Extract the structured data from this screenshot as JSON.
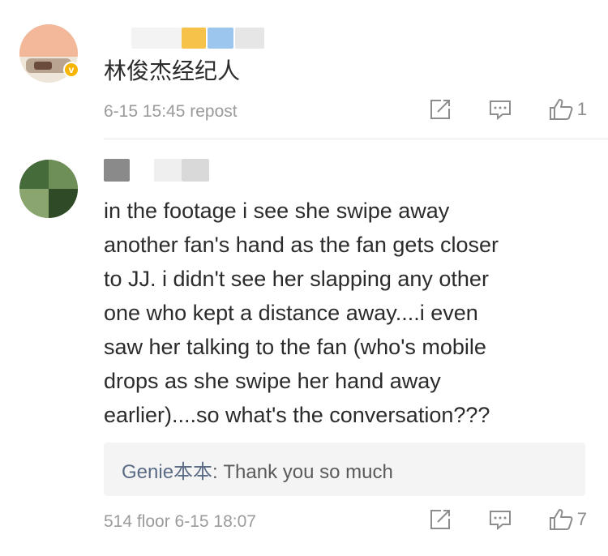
{
  "comments": [
    {
      "username_blur_colors": [
        "#f3f3f3",
        "#f6c24a",
        "#9cc6ee",
        "#e6e6e6"
      ],
      "verified_badge": "v",
      "text": "林俊杰经纪人",
      "meta": "6-15 15:45 repost",
      "actions": {
        "like_count": "1"
      }
    },
    {
      "username_blur_colors": [
        "#8a8a8a",
        "#efefef",
        "#d9d9d9"
      ],
      "lines": [
        "in the footage i see she swipe away",
        "another fan's hand as the fan gets closer",
        "to JJ.  i didn't see her slapping any other",
        "one who kept a distance away....i even",
        "saw her talking to the fan (who's mobile",
        "drops as she swipe her hand away",
        "earlier)....so what's the conversation???"
      ],
      "reply": {
        "user": "Genie本本",
        "separator": ": ",
        "text": "Thank you so much"
      },
      "meta": "514 floor 6-15 18:07",
      "actions": {
        "like_count": "7"
      }
    }
  ],
  "icons": {
    "share": "share-icon",
    "comment": "comment-icon",
    "like": "thumbs-up-icon"
  }
}
